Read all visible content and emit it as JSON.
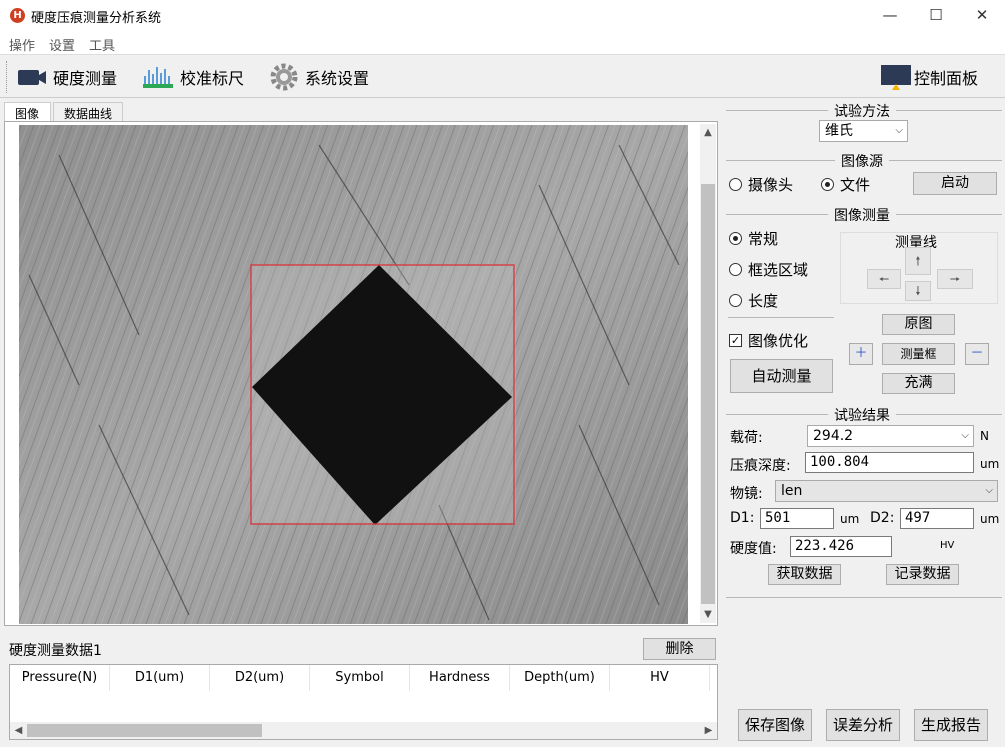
{
  "window": {
    "title": "硬度压痕测量分析系统",
    "minimize": "—",
    "maximize": "☐",
    "close": "✕"
  },
  "menu": [
    "操作",
    "设置",
    "工具"
  ],
  "toolbar": {
    "hardness_measure": "硬度测量",
    "calibration_ruler": "校准标尺",
    "system_settings": "系统设置",
    "control_panel": "控制面板"
  },
  "tabs": [
    "图像",
    "数据曲线"
  ],
  "data_table": {
    "title": "硬度测量数据1",
    "delete_label": "删除",
    "columns": [
      "Pressure(N)",
      "D1(um)",
      "D2(um)",
      "Symbol",
      "Hardness",
      "Depth(um)",
      "HV"
    ]
  },
  "test_method": {
    "title": "试验方法",
    "selected": "维氏"
  },
  "image_source": {
    "title": "图像源",
    "camera": "摄像头",
    "file": "文件",
    "selected": "file",
    "start_label": "启动"
  },
  "image_measure": {
    "title": "图像测量",
    "modes": [
      "常规",
      "框选区域",
      "长度"
    ],
    "selected_mode": "常规",
    "optimize_label": "图像优化",
    "optimize_checked": true,
    "auto_measure_label": "自动测量",
    "measure_line_title": "测量线",
    "arrows": {
      "up": "🠕",
      "down": "🠗",
      "left": "🠔",
      "right": "🠖"
    },
    "original_label": "原图",
    "measure_box_label": "测量框",
    "fill_label": "充满",
    "zoom_in": "＋",
    "zoom_out": "－"
  },
  "test_result": {
    "title": "试验结果",
    "load_label": "载荷:",
    "load_value": "294.2",
    "load_unit": "N",
    "depth_label": "压痕深度:",
    "depth_value": "100.804",
    "depth_unit": "um",
    "objective_label": "物镜:",
    "objective_value": "len",
    "d1_label": "D1:",
    "d1_value": "501",
    "d1_unit": "um",
    "d2_label": "D2:",
    "d2_value": "497",
    "d2_unit": "um",
    "hardness_label": "硬度值:",
    "hardness_value": "223.426",
    "hardness_unit": "HV",
    "get_data_label": "获取数据",
    "record_data_label": "记录数据"
  },
  "footer_buttons": {
    "save_image": "保存图像",
    "error_analysis": "误差分析",
    "generate_report": "生成报告"
  },
  "colors": {
    "selection_box": "#d9343b",
    "indent": "#111111",
    "surface": "#9a9a9a"
  }
}
